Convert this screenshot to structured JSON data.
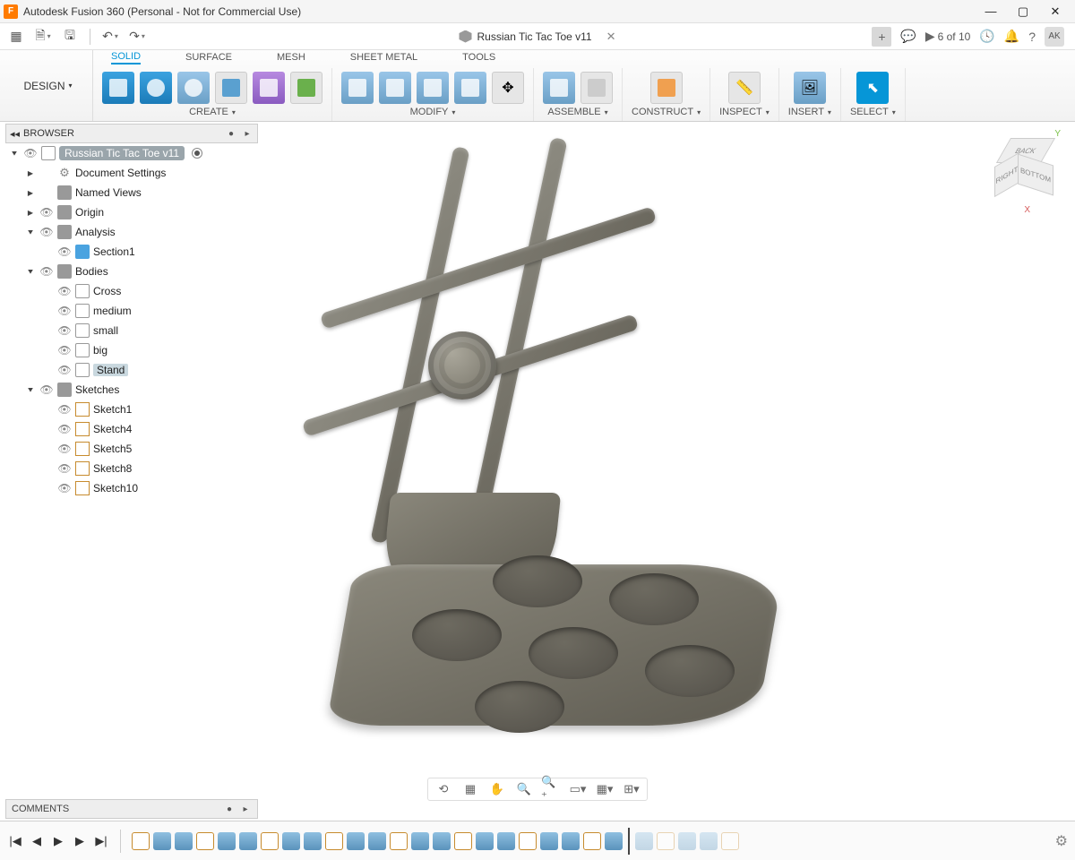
{
  "title": "Autodesk Fusion 360 (Personal - Not for Commercial Use)",
  "logo": "F",
  "document": "Russian Tic Tac Toe v11",
  "qat": {
    "jobs": "6 of 10",
    "avatar": "AK",
    "plus": "+"
  },
  "design_btn": "DESIGN",
  "ribbon_tabs": [
    "SOLID",
    "SURFACE",
    "MESH",
    "SHEET METAL",
    "TOOLS"
  ],
  "ribbon_groups": {
    "create": "CREATE",
    "modify": "MODIFY",
    "assemble": "ASSEMBLE",
    "construct": "CONSTRUCT",
    "inspect": "INSPECT",
    "insert": "INSERT",
    "select": "SELECT"
  },
  "browser": {
    "header": "BROWSER",
    "root": "Russian Tic Tac Toe v11",
    "doc_settings": "Document Settings",
    "named_views": "Named Views",
    "origin": "Origin",
    "analysis": "Analysis",
    "section1": "Section1",
    "bodies": "Bodies",
    "body_items": [
      "Cross",
      "medium",
      "small",
      "big",
      "Stand"
    ],
    "sketches": "Sketches",
    "sketch_items": [
      "Sketch1",
      "Sketch4",
      "Sketch5",
      "Sketch8",
      "Sketch10"
    ]
  },
  "viewcube": {
    "top": "BACK",
    "front": "BOTTOM",
    "right": "RIGHT",
    "y": "Y",
    "x": "X"
  },
  "comments": "COMMENTS"
}
